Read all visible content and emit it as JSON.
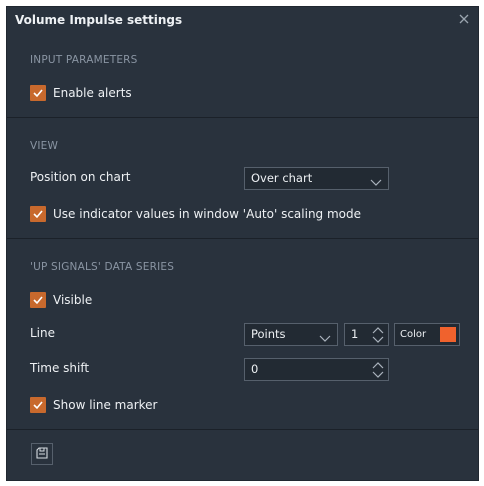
{
  "dialog": {
    "title": "Volume Impulse settings"
  },
  "sections": {
    "input": {
      "heading": "INPUT PARAMETERS",
      "enable_alerts": {
        "label": "Enable alerts",
        "checked": true
      }
    },
    "view": {
      "heading": "VIEW",
      "position_label": "Position on chart",
      "position_value": "Over chart",
      "auto_scaling": {
        "label": "Use indicator values in window 'Auto' scaling mode",
        "checked": true
      }
    },
    "up_signals": {
      "heading": "'UP SIGNALS' DATA SERIES",
      "visible": {
        "label": "Visible",
        "checked": true
      },
      "line_label": "Line",
      "line_style": "Points",
      "line_width": "1",
      "color_label": "Color",
      "color": "#f0622d",
      "time_shift_label": "Time shift",
      "time_shift_value": "0",
      "show_marker": {
        "label": "Show line marker",
        "checked": true
      }
    }
  },
  "colors": {
    "accent": "#c8692d",
    "background": "#29323d"
  },
  "icons": {
    "close": "close-icon",
    "check": "checkmark-icon",
    "chevron": "chevron-down-icon",
    "spin": "spin-arrows-icon",
    "save": "save-template-icon"
  }
}
